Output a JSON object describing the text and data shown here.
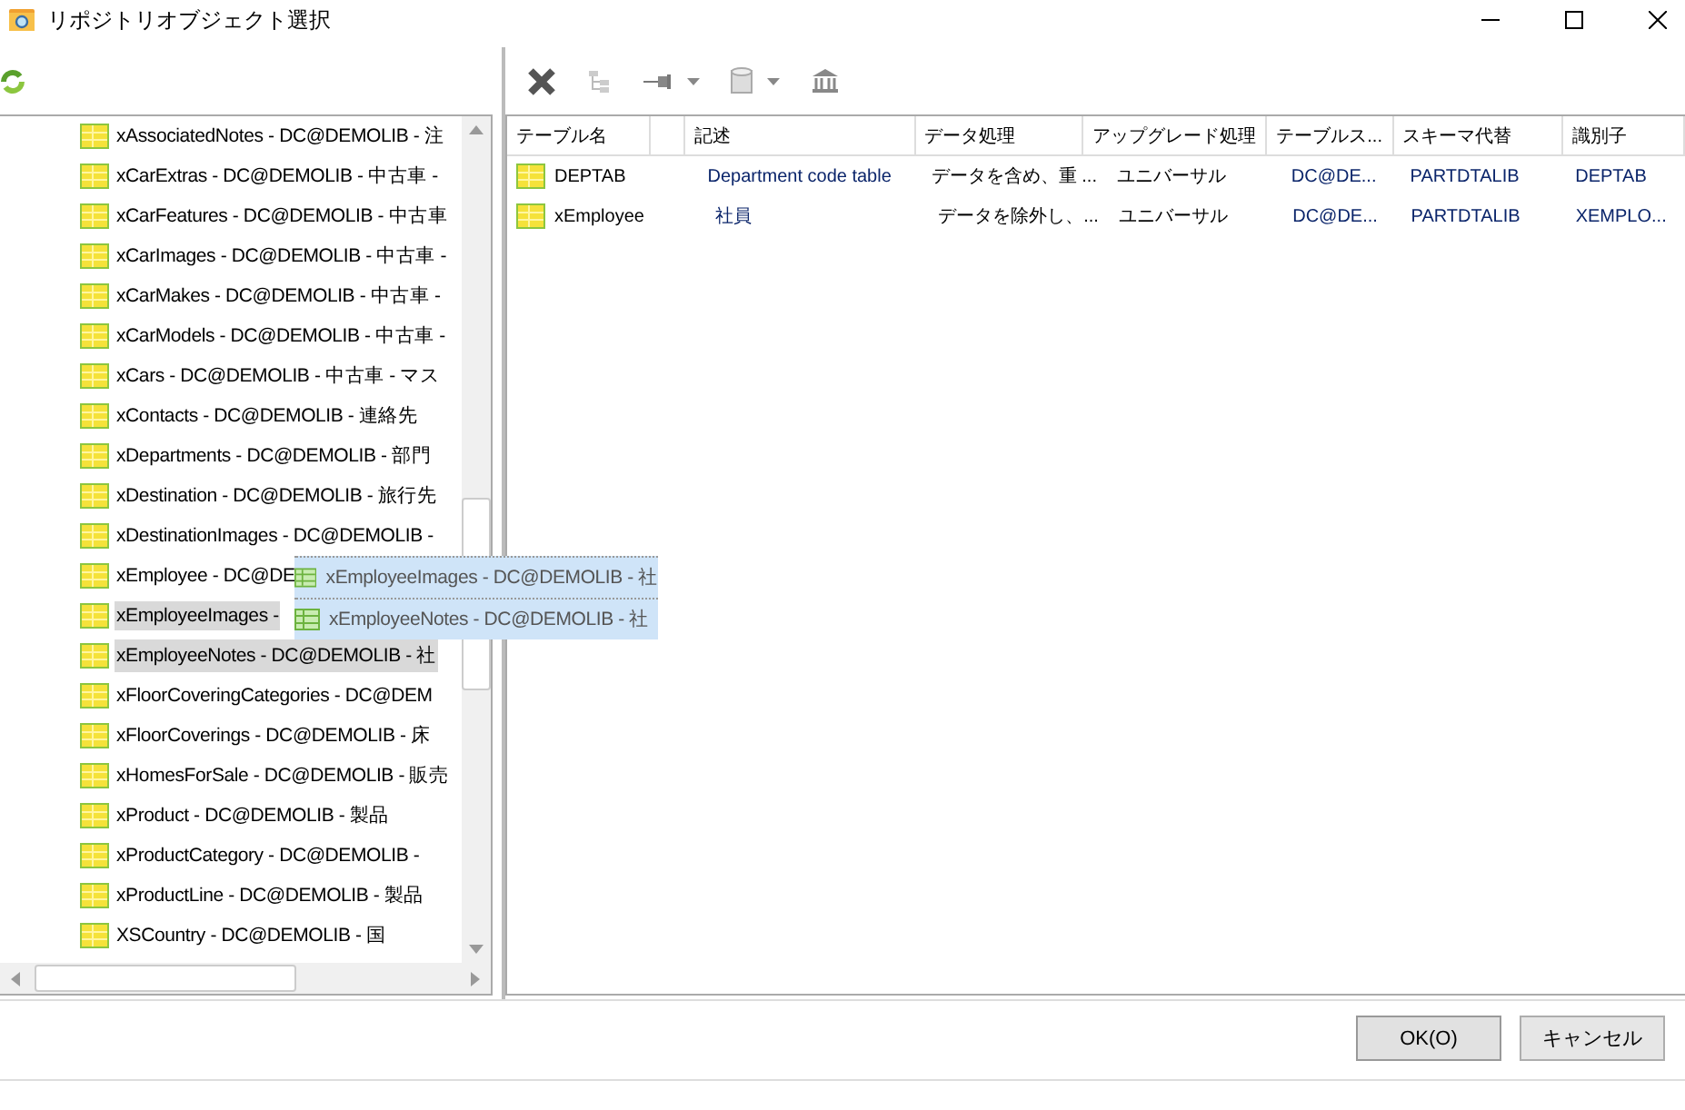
{
  "window": {
    "title": "リポジトリオブジェクト選択"
  },
  "tree": {
    "items": [
      {
        "label": "xAssociatedNotes - DC@DEMOLIB - 注",
        "selected": false
      },
      {
        "label": "xCarExtras - DC@DEMOLIB - 中古車 -",
        "selected": false
      },
      {
        "label": "xCarFeatures - DC@DEMOLIB - 中古車",
        "selected": false
      },
      {
        "label": "xCarImages - DC@DEMOLIB - 中古車 -",
        "selected": false
      },
      {
        "label": "xCarMakes - DC@DEMOLIB - 中古車 -",
        "selected": false
      },
      {
        "label": "xCarModels - DC@DEMOLIB - 中古車 -",
        "selected": false
      },
      {
        "label": "xCars - DC@DEMOLIB - 中古車 - マス",
        "selected": false
      },
      {
        "label": "xContacts - DC@DEMOLIB - 連絡先",
        "selected": false
      },
      {
        "label": "xDepartments - DC@DEMOLIB - 部門",
        "selected": false
      },
      {
        "label": "xDestination - DC@DEMOLIB - 旅行先",
        "selected": false
      },
      {
        "label": "xDestinationImages - DC@DEMOLIB -",
        "selected": false
      },
      {
        "label": "xEmployee - DC@DE",
        "selected": false
      },
      {
        "label": "xEmployeeImages -",
        "selected": true
      },
      {
        "label": "xEmployeeNotes - DC@DEMOLIB - 社",
        "selected": true
      },
      {
        "label": "xFloorCoveringCategories - DC@DEM",
        "selected": false
      },
      {
        "label": "xFloorCoverings - DC@DEMOLIB - 床",
        "selected": false
      },
      {
        "label": "xHomesForSale - DC@DEMOLIB - 販売",
        "selected": false
      },
      {
        "label": "xProduct - DC@DEMOLIB - 製品",
        "selected": false
      },
      {
        "label": "xProductCategory - DC@DEMOLIB -",
        "selected": false
      },
      {
        "label": "xProductLine - DC@DEMOLIB - 製品",
        "selected": false
      },
      {
        "label": "XSCountry - DC@DEMOLIB - 国",
        "selected": false
      }
    ]
  },
  "drag_preview": {
    "items": [
      "xEmployeeImages - DC@DEMOLIB - 社",
      "xEmployeeNotes - DC@DEMOLIB - 社"
    ]
  },
  "table": {
    "columns": [
      "テーブル名",
      "記述",
      "データ処理",
      "アップグレード処理",
      "テーブルス...",
      "スキーマ代替",
      "識別子"
    ],
    "rows": [
      [
        "DEPTAB",
        "Department code table",
        "データを含め、重 ...",
        "ユニバーサル",
        "DC@DE...",
        "PARTDTALIB",
        "DEPTAB"
      ],
      [
        "xEmployee",
        "社員",
        "データを除外し、...",
        "ユニバーサル",
        "DC@DE...",
        "PARTDTALIB",
        "XEMPLO..."
      ]
    ]
  },
  "buttons": [
    {
      "label": "OK(O)",
      "default": true
    },
    {
      "label": "キャンセル",
      "default": false
    }
  ]
}
